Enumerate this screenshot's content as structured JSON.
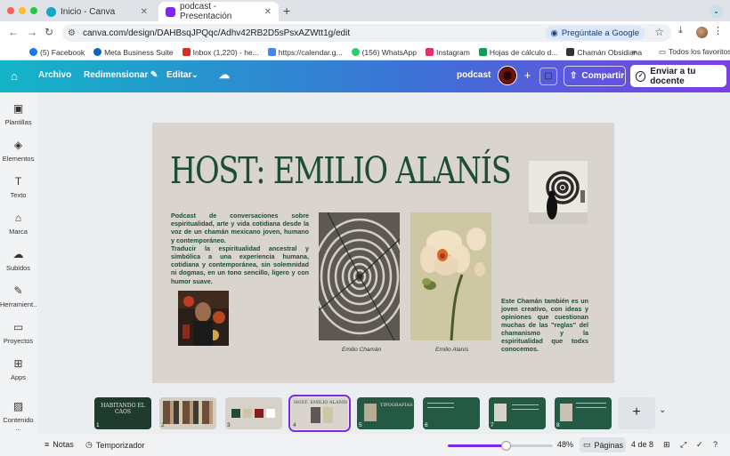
{
  "browser": {
    "tabs": [
      {
        "title": "Inicio - Canva",
        "favicon_color": "#1aa3c9"
      },
      {
        "title": "podcast - Presentación",
        "favicon_color": "#7d2ae8"
      }
    ],
    "url": "canva.com/design/DAHBsqJPQqc/Adhv42RB2D5sPsxAZWtt1g/edit",
    "ask_google": "Pregúntale a Google",
    "bookmarks": [
      {
        "label": "(5) Facebook",
        "color": "#1877f2"
      },
      {
        "label": "Meta Business Suite",
        "color": "#0a66c2"
      },
      {
        "label": "Inbox (1,220) - he...",
        "color": "#d93025"
      },
      {
        "label": "https://calendar.g...",
        "color": "#4285f4"
      },
      {
        "label": "(156) WhatsApp",
        "color": "#25d366"
      },
      {
        "label": "Instagram",
        "color": "#e1306c"
      },
      {
        "label": "Hojas de cálculo d...",
        "color": "#0f9d58"
      },
      {
        "label": "Chamán Obsidiana",
        "color": "#333333"
      }
    ],
    "bookmarks_more": "»",
    "all_bookmarks": "Todos los favoritos"
  },
  "canva_header": {
    "file": "Archivo",
    "resize": "Redimensionar",
    "edit": "Editar",
    "doc_title": "podcast",
    "share": "Compartir",
    "send": "Enviar a tu docente"
  },
  "rail": [
    {
      "label": "Plantillas",
      "icon": "layout-icon",
      "glyph": "▣"
    },
    {
      "label": "Elementos",
      "icon": "shapes-icon",
      "glyph": "◈"
    },
    {
      "label": "Texto",
      "icon": "text-icon",
      "glyph": "T"
    },
    {
      "label": "Marca",
      "icon": "brand-icon",
      "glyph": "⌂"
    },
    {
      "label": "Subidos",
      "icon": "upload-icon",
      "glyph": "☁"
    },
    {
      "label": "Herramient...",
      "icon": "tools-icon",
      "glyph": "✎"
    },
    {
      "label": "Proyectos",
      "icon": "folder-icon",
      "glyph": "▭"
    },
    {
      "label": "Apps",
      "icon": "apps-icon",
      "glyph": "⊞"
    },
    {
      "label": "Contenido ...",
      "icon": "media-icon",
      "glyph": "▨"
    }
  ],
  "slide": {
    "title": "HOST: EMILIO ALANÍS",
    "desc_p1": "Podcast de conversaciones sobre espiritualidad, arte y vida cotidiana desde la voz de un chamán mexicano joven, humano y contemporáneo.",
    "desc_p2": "Traducir la espiritualidad ancestral y simbólica a una experiencia humana, cotidiana y contemporánea, sin solemnidad ni dogmas, en un tono sencillo, ligero y con humor suave.",
    "desc2": "Este Chamán también es un joven creativo, con ideas y opiniones que cuestionan muchas de las \"reglas\" del chamanismo y la espiritualidad que todxs conocemos.",
    "caption1": "Emilio Chamán",
    "caption2": "Emilio Alanís",
    "title_color": "#1d4d38",
    "bg_color": "#d9d4cd"
  },
  "thumbs": [
    {
      "num": "1",
      "label": "HABITANDO EL CAOS"
    },
    {
      "num": "2",
      "label": ""
    },
    {
      "num": "3",
      "label": ""
    },
    {
      "num": "4",
      "label": "HOST: EMILIO ALANÍS"
    },
    {
      "num": "5",
      "label": "TIPOGRAFÍAS"
    },
    {
      "num": "6",
      "label": ""
    },
    {
      "num": "7",
      "label": ""
    },
    {
      "num": "8",
      "label": ""
    }
  ],
  "footer": {
    "notes": "Notas",
    "timer": "Temporizador",
    "zoom": "48%",
    "zoom_fraction": 0.48,
    "pages": "Páginas",
    "page_count": "4 de 8"
  },
  "accent": "#7d2ae8"
}
